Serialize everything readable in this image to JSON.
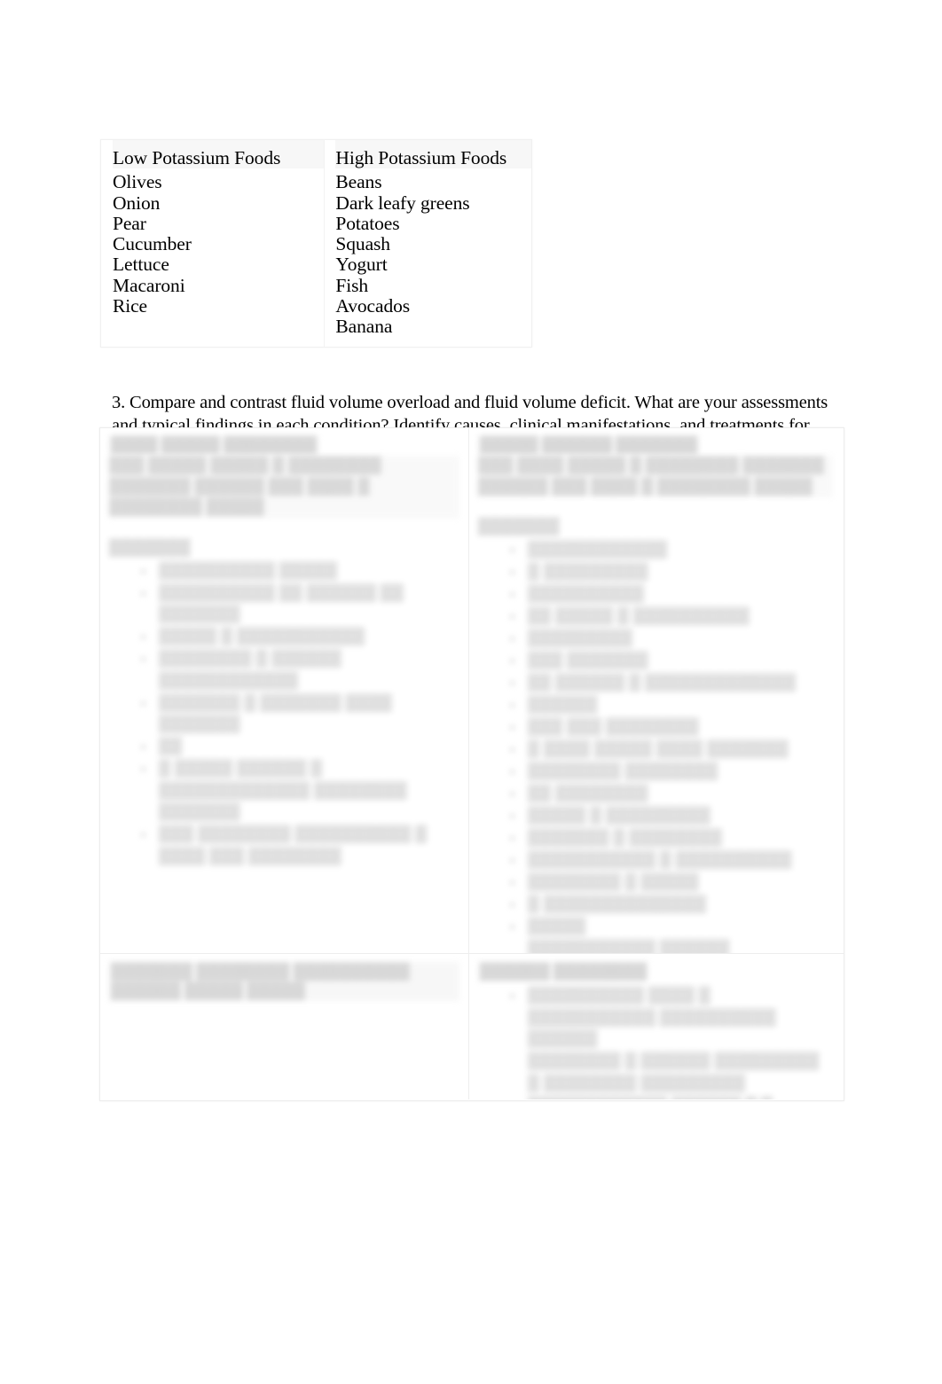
{
  "document": {
    "background_color": "#ffffff",
    "text_color": "#000000",
    "border_color": "#ededed"
  },
  "potassium_table": {
    "name": "potassium-foods-table",
    "columns": [
      {
        "header": "Low Potassium Foods",
        "items": [
          "Olives",
          "Onion",
          "Pear",
          "Cucumber",
          "Lettuce",
          "Macaroni",
          "Rice"
        ]
      },
      {
        "header": "High Potassium Foods",
        "items": [
          "Beans",
          "Dark leafy greens",
          "Potatoes",
          "Squash",
          "Yogurt",
          "Fish",
          "Avocados",
          "Banana"
        ]
      }
    ]
  },
  "question": {
    "number": "3.",
    "text": "3. Compare and contrast fluid volume overload and fluid volume deficit.  What are your assessments and typical findings in each condition? Identify causes, clinical manifestations, and treatments for each."
  },
  "fluid_volume_table": {
    "name": "fluid-volume-comparison-table",
    "note": "Text in this table is blurred/obscured in the source image and is not legible.",
    "left_column": {
      "title": "▒▒▒▒ ▒▒▒▒▒ ▒▒▒▒▒▒▒▒",
      "subtitle": "▒▒▒ ▒▒▒▒▒ ▒▒▒▒▒ ▒ ▒▒▒▒▒▒▒▒ ▒▒▒▒▒▒▒ ▒▒▒▒▒▒ ▒▒▒ ▒▒▒▒ ▒ ▒▒▒▒▒▒▒▒ ▒▒▒▒▒",
      "section_label": "▒▒▒▒▒▒▒",
      "bullets": [
        "▒▒▒▒▒▒▒▒▒▒ ▒▒▒▒▒",
        "▒▒▒▒▒▒▒▒▒▒ ▒▒ ▒▒▒▒▒▒ ▒▒ ▒▒▒▒▒▒▒",
        "▒▒▒▒▒ ▒ ▒▒▒▒▒▒▒▒▒▒▒",
        "▒▒▒▒▒▒▒▒ ▒ ▒▒▒▒▒▒ ▒▒▒▒▒▒▒▒▒▒▒▒",
        "▒▒▒▒▒▒▒ ▒ ▒▒▒▒▒▒▒ ▒▒▒▒ ▒▒▒▒▒▒▒",
        "▒▒",
        "▒ ▒▒▒▒▒ ▒▒▒▒▒▒ ▒ ▒▒▒▒▒▒▒▒▒▒▒▒▒ ▒▒▒▒▒▒▒▒ ▒▒▒▒▒▒▒",
        "▒▒▒ ▒▒▒▒▒▒▒▒ ▒▒▒▒▒▒▒▒▒▒ ▒ ▒▒▒▒ ▒▒▒ ▒▒▒▒▒▒▒▒"
      ],
      "bottom_title": "▒▒▒▒▒▒▒ ▒▒▒▒▒▒▒▒   ▒▒▒▒▒▒▒▒▒▒ ▒▒▒▒▒▒ ▒▒▒▒▒ ▒▒▒▒▒",
      "bottom_bullets": []
    },
    "right_column": {
      "title": "▒▒▒▒▒ ▒▒▒▒▒▒ ▒▒▒▒▒▒▒",
      "subtitle": "▒▒▒ ▒▒▒▒ ▒▒▒▒▒ ▒ ▒▒▒▒▒▒▒▒ ▒▒▒▒▒▒▒ ▒▒▒▒▒▒ ▒▒▒ ▒▒▒▒ ▒ ▒▒▒▒▒▒▒▒ ▒▒▒▒▒",
      "section_label": "▒▒▒▒▒▒▒",
      "bullets": [
        "▒▒▒▒▒▒▒▒▒▒▒▒",
        "▒ ▒▒▒▒▒▒▒▒▒",
        "▒▒▒▒▒▒▒▒▒▒",
        "▒▒ ▒▒▒▒▒ ▒ ▒▒▒▒▒▒▒▒▒▒",
        "▒▒▒▒▒▒▒▒▒",
        "▒▒▒ ▒▒▒▒▒▒▒",
        "▒▒ ▒▒▒▒▒▒ ▒ ▒▒▒▒▒▒▒▒▒▒▒▒▒",
        "▒▒▒▒▒▒",
        "▒▒▒ ▒▒▒ ▒▒▒▒▒▒▒▒",
        "▒ ▒▒▒▒ ▒▒▒▒▒ ▒▒▒▒ ▒▒▒▒▒▒▒",
        "▒▒▒▒▒▒▒▒ ▒▒▒▒▒▒▒▒",
        "▒▒ ▒▒▒▒▒▒▒▒",
        "▒▒▒▒▒ ▒ ▒▒▒▒▒▒▒▒▒",
        "▒▒▒▒▒▒▒ ▒ ▒▒▒▒▒▒▒▒",
        "▒▒▒▒▒▒▒▒▒▒▒ ▒ ▒▒▒▒▒▒▒▒▒▒",
        "▒▒▒▒▒▒▒▒ ▒ ▒▒▒▒▒",
        "▒ ▒▒▒▒▒▒▒▒▒▒▒▒▒▒",
        "▒▒▒▒▒",
        "▒▒▒▒▒▒▒▒▒▒▒ ▒▒▒▒▒▒ ▒▒▒▒▒▒▒▒▒"
      ],
      "bottom_title": "▒▒▒▒▒▒ ▒▒▒▒▒▒▒▒",
      "bottom_bullets": [
        "▒▒▒▒▒▒▒▒▒▒ ▒▒▒▒ ▒ ▒▒▒▒▒▒▒▒▒▒▒ ▒▒▒▒▒▒▒▒▒▒ ▒▒▒▒▒▒",
        "▒▒▒▒▒▒▒▒ ▒ ▒▒▒▒▒▒ ▒▒▒▒▒▒▒▒▒ ▒ ▒▒▒▒▒▒▒▒ ▒▒▒▒▒▒▒▒▒",
        "▒▒▒▒▒▒▒▒▒▒▒▒ ▒▒▒▒▒▒  ▒ ▒ ▒▒▒▒▒▒▒▒▒ ▒ ▒ ▒▒▒▒ ▒▒▒▒▒▒ ▒▒▒▒ ▒▒▒",
        "▒▒▒▒▒▒▒▒ ▒ ▒▒▒▒▒▒▒▒▒▒▒",
        "▒▒▒▒▒▒▒▒▒▒▒ ▒ ▒▒▒▒▒▒▒▒▒   ▒ ▒▒▒▒▒▒ ▒▒▒▒ ▒▒▒▒▒▒▒▒▒▒▒▒▒"
      ]
    }
  }
}
